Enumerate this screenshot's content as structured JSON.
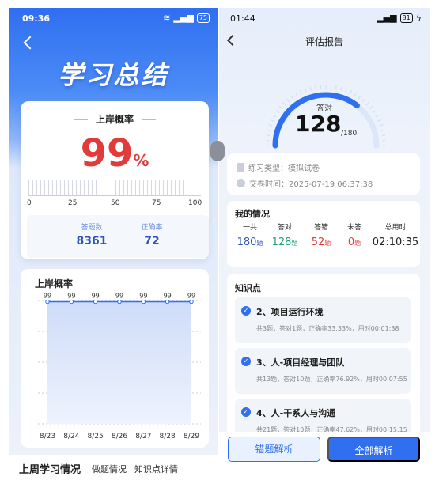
{
  "left": {
    "status_time": "09:36",
    "battery": "75",
    "hero_title": "学习总结",
    "rate_title": "上岸概率",
    "rate_value": "99",
    "rate_unit": "%",
    "scale_labels": [
      "0",
      "25",
      "50",
      "75",
      "100"
    ],
    "stats": [
      {
        "label": "答题数",
        "value": "8361"
      },
      {
        "label": "正确率",
        "value": "72"
      }
    ],
    "chart_title": "上岸概率",
    "bottom_title": "上周学习情况",
    "bottom_tabs": [
      "做题情况",
      "知识点详情"
    ]
  },
  "chart_data": {
    "type": "area",
    "title": "上岸概率",
    "categories": [
      "8/23",
      "8/24",
      "8/25",
      "8/26",
      "8/27",
      "8/28",
      "8/29"
    ],
    "values": [
      99,
      99,
      99,
      99,
      99,
      99,
      99
    ],
    "ylim": [
      0,
      100
    ],
    "grid": true,
    "data_labels": true,
    "line_color": "#2f6ff0"
  },
  "right": {
    "status_time": "01:44",
    "battery": "81",
    "page_title": "评估报告",
    "gauge_label": "答对",
    "score": "128",
    "score_total": "/180",
    "score_fraction": 0.711,
    "practice_type": "练习类型：模拟试卷",
    "submit_time": "交卷时间：2025-07-19 06:37:38",
    "my_title": "我的情况",
    "my_stats": [
      {
        "head": "一共",
        "value": "180",
        "unit": "题",
        "color": "#2d55b8"
      },
      {
        "head": "答对",
        "value": "128",
        "unit": "题",
        "color": "#1aa37a"
      },
      {
        "head": "答错",
        "value": "52",
        "unit": "题",
        "color": "#e23b3b"
      },
      {
        "head": "未答",
        "value": "0",
        "unit": "题",
        "color": "#e23b3b"
      },
      {
        "head": "总用时",
        "value": "02:10:35",
        "unit": "",
        "color": "#222222"
      }
    ],
    "kp_title": "知识点",
    "knowledge": [
      {
        "name": "2、项目运行环境",
        "detail": "共3题，答对1题，正确率33.33%，用时00:01:38"
      },
      {
        "name": "3、人-项目经理与团队",
        "detail": "共13题，答对10题，正确率76.92%，用时00:07:55"
      },
      {
        "name": "4、人-干系人与沟通",
        "detail": "共21题，答对10题，正确率47.62%，用时00:15:15"
      }
    ],
    "btn_wrong": "错题解析",
    "btn_all": "全部解析"
  },
  "colors": {
    "accent": "#2f6ff0",
    "score_red": "#e23b3b"
  }
}
